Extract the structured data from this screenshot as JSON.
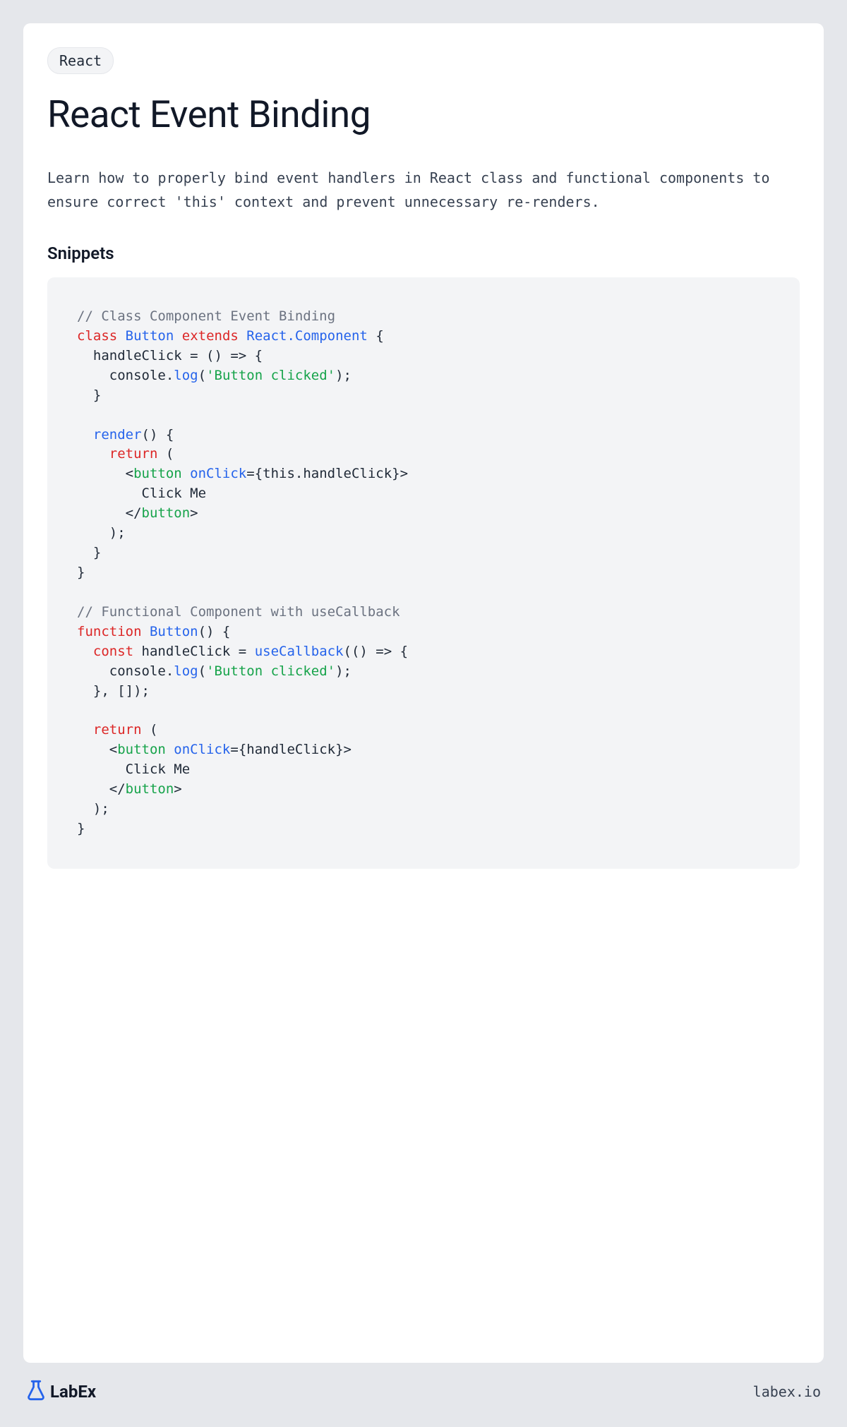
{
  "tag": "React",
  "title": "React Event Binding",
  "description": "Learn how to properly bind event handlers in React class and functional components to ensure correct 'this' context and prevent unnecessary re-renders.",
  "section_heading": "Snippets",
  "code": {
    "comment1": "// Class Component Event Binding",
    "kw_class": "class",
    "cls_Button1": "Button",
    "kw_extends": "extends",
    "cls_ReactComponent": "React.Component",
    "brace_open1": " {",
    "line_handleClick_decl": "  handleClick = () => {",
    "indent_console1_a": "    console.",
    "m_log1": "log",
    "paren_open1": "(",
    "str_clicked1": "'Button clicked'",
    "paren_close1": ");",
    "line_close_arrow": "  }",
    "blank1": "",
    "indent_render": "  ",
    "m_render": "render",
    "render_sig": "() {",
    "indent_return1": "    ",
    "kw_return1": "return",
    "return_open1": " (",
    "jsx_open_pre1": "      <",
    "tag_button1": "button",
    "space1": " ",
    "attr_onClick1": "onClick",
    "onclick_val1": "={this.handleClick}>",
    "jsx_text1": "        Click Me",
    "jsx_close_pre1": "      </",
    "tag_button_close1": "button",
    "jsx_close_suf1": ">",
    "return_close1": "    );",
    "render_close": "  }",
    "class_close": "}",
    "blank2": "",
    "comment2": "// Functional Component with useCallback",
    "kw_function": "function",
    "space2": " ",
    "cls_Button2": "Button",
    "fn_sig": "() {",
    "indent_const": "  ",
    "kw_const": "const",
    "const_decl": " handleClick = ",
    "fn_useCallback": "useCallback",
    "ucb_open": "(() => {",
    "indent_console2_a": "    console.",
    "m_log2": "log",
    "paren_open2": "(",
    "str_clicked2": "'Button clicked'",
    "paren_close2": ");",
    "ucb_close": "  }, []);",
    "blank3": "",
    "indent_return2": "  ",
    "kw_return2": "return",
    "return_open2": " (",
    "jsx_open_pre2": "    <",
    "tag_button2": "button",
    "space3": " ",
    "attr_onClick2": "onClick",
    "onclick_val2": "={handleClick}>",
    "jsx_text2": "      Click Me",
    "jsx_close_pre2": "    </",
    "tag_button_close2": "button",
    "jsx_close_suf2": ">",
    "return_close2": "  );",
    "fn_close": "}"
  },
  "footer": {
    "brand": "LabEx",
    "link": "labex.io"
  }
}
